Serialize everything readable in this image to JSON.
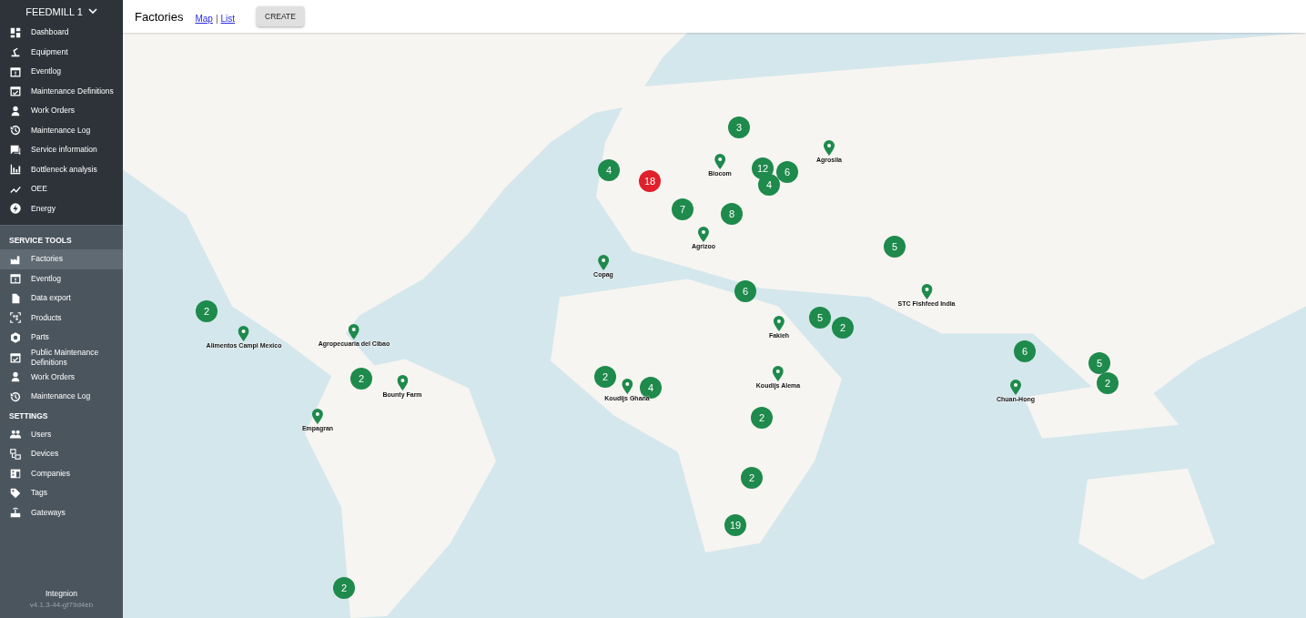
{
  "sidebar": {
    "workspace": "FEEDMILL 1",
    "sections": [
      {
        "items": [
          {
            "label": "Dashboard",
            "selected": false
          },
          {
            "label": "Equipment",
            "selected": false
          },
          {
            "label": "Eventlog",
            "selected": false
          },
          {
            "label": "Maintenance Definitions",
            "selected": false
          },
          {
            "label": "Work Orders",
            "selected": false
          },
          {
            "label": "Maintenance Log",
            "selected": false
          },
          {
            "label": "Service information",
            "selected": false
          },
          {
            "label": "Bottleneck analysis",
            "selected": false
          },
          {
            "label": "OEE",
            "selected": false
          },
          {
            "label": "Energy",
            "selected": false
          }
        ]
      },
      {
        "title": "SERVICE TOOLS",
        "items": [
          {
            "label": "Factories",
            "selected": true
          },
          {
            "label": "Eventlog",
            "selected": false
          },
          {
            "label": "Data export",
            "selected": false
          },
          {
            "label": "Products",
            "selected": false
          },
          {
            "label": "Parts",
            "selected": false
          },
          {
            "label": "Public Maintenance Definitions",
            "selected": false
          },
          {
            "label": "Work Orders",
            "selected": false
          },
          {
            "label": "Maintenance Log",
            "selected": false
          }
        ]
      },
      {
        "title": "SETTINGS",
        "items": [
          {
            "label": "Users",
            "selected": false
          },
          {
            "label": "Devices",
            "selected": false
          },
          {
            "label": "Companies",
            "selected": false
          },
          {
            "label": "Tags",
            "selected": false
          },
          {
            "label": "Gateways",
            "selected": false
          }
        ]
      }
    ],
    "footer": {
      "company": "Integnion",
      "version": "v4.1.3-44-gf79d4eb"
    }
  },
  "header": {
    "title": "Factories",
    "view_links": [
      "Map",
      "List"
    ],
    "separator": "|",
    "create_button": "CREATE"
  },
  "map": {
    "clusters": [
      {
        "count": "3",
        "color": "#1e8a4c"
      },
      {
        "count": "4",
        "color": "#1e8a4c"
      },
      {
        "count": "18",
        "color": "#e0202a"
      },
      {
        "count": "12",
        "color": "#1e8a4c"
      },
      {
        "count": "6",
        "color": "#1e8a4c"
      },
      {
        "count": "4",
        "color": "#1e8a4c"
      },
      {
        "count": "7",
        "color": "#1e8a4c"
      },
      {
        "count": "8",
        "color": "#1e8a4c"
      },
      {
        "count": "5",
        "color": "#1e8a4c"
      },
      {
        "count": "2",
        "color": "#1e8a4c"
      },
      {
        "count": "6",
        "color": "#1e8a4c"
      },
      {
        "count": "5",
        "color": "#1e8a4c"
      },
      {
        "count": "2",
        "color": "#1e8a4c"
      },
      {
        "count": "2",
        "color": "#1e8a4c"
      },
      {
        "count": "2",
        "color": "#1e8a4c"
      },
      {
        "count": "4",
        "color": "#1e8a4c"
      },
      {
        "count": "6",
        "color": "#1e8a4c"
      },
      {
        "count": "5",
        "color": "#1e8a4c"
      },
      {
        "count": "2",
        "color": "#1e8a4c"
      },
      {
        "count": "2",
        "color": "#1e8a4c"
      },
      {
        "count": "2",
        "color": "#1e8a4c"
      },
      {
        "count": "19",
        "color": "#1e8a4c"
      },
      {
        "count": "2",
        "color": "#1e8a4c"
      }
    ],
    "pins": [
      {
        "label": "Agrosila"
      },
      {
        "label": "Biocom"
      },
      {
        "label": "Agrizoo"
      },
      {
        "label": "Copag"
      },
      {
        "label": "STC Fishfeed India"
      },
      {
        "label": "Fakieh"
      },
      {
        "label": "Alimentos Campi Mexico"
      },
      {
        "label": "Agropecuaria del Cibao"
      },
      {
        "label": "Bounty Farm"
      },
      {
        "label": "Koudijs Ghana"
      },
      {
        "label": "Koudijs Alema"
      },
      {
        "label": "Chuan-Hong"
      },
      {
        "label": "Empagran"
      }
    ]
  }
}
